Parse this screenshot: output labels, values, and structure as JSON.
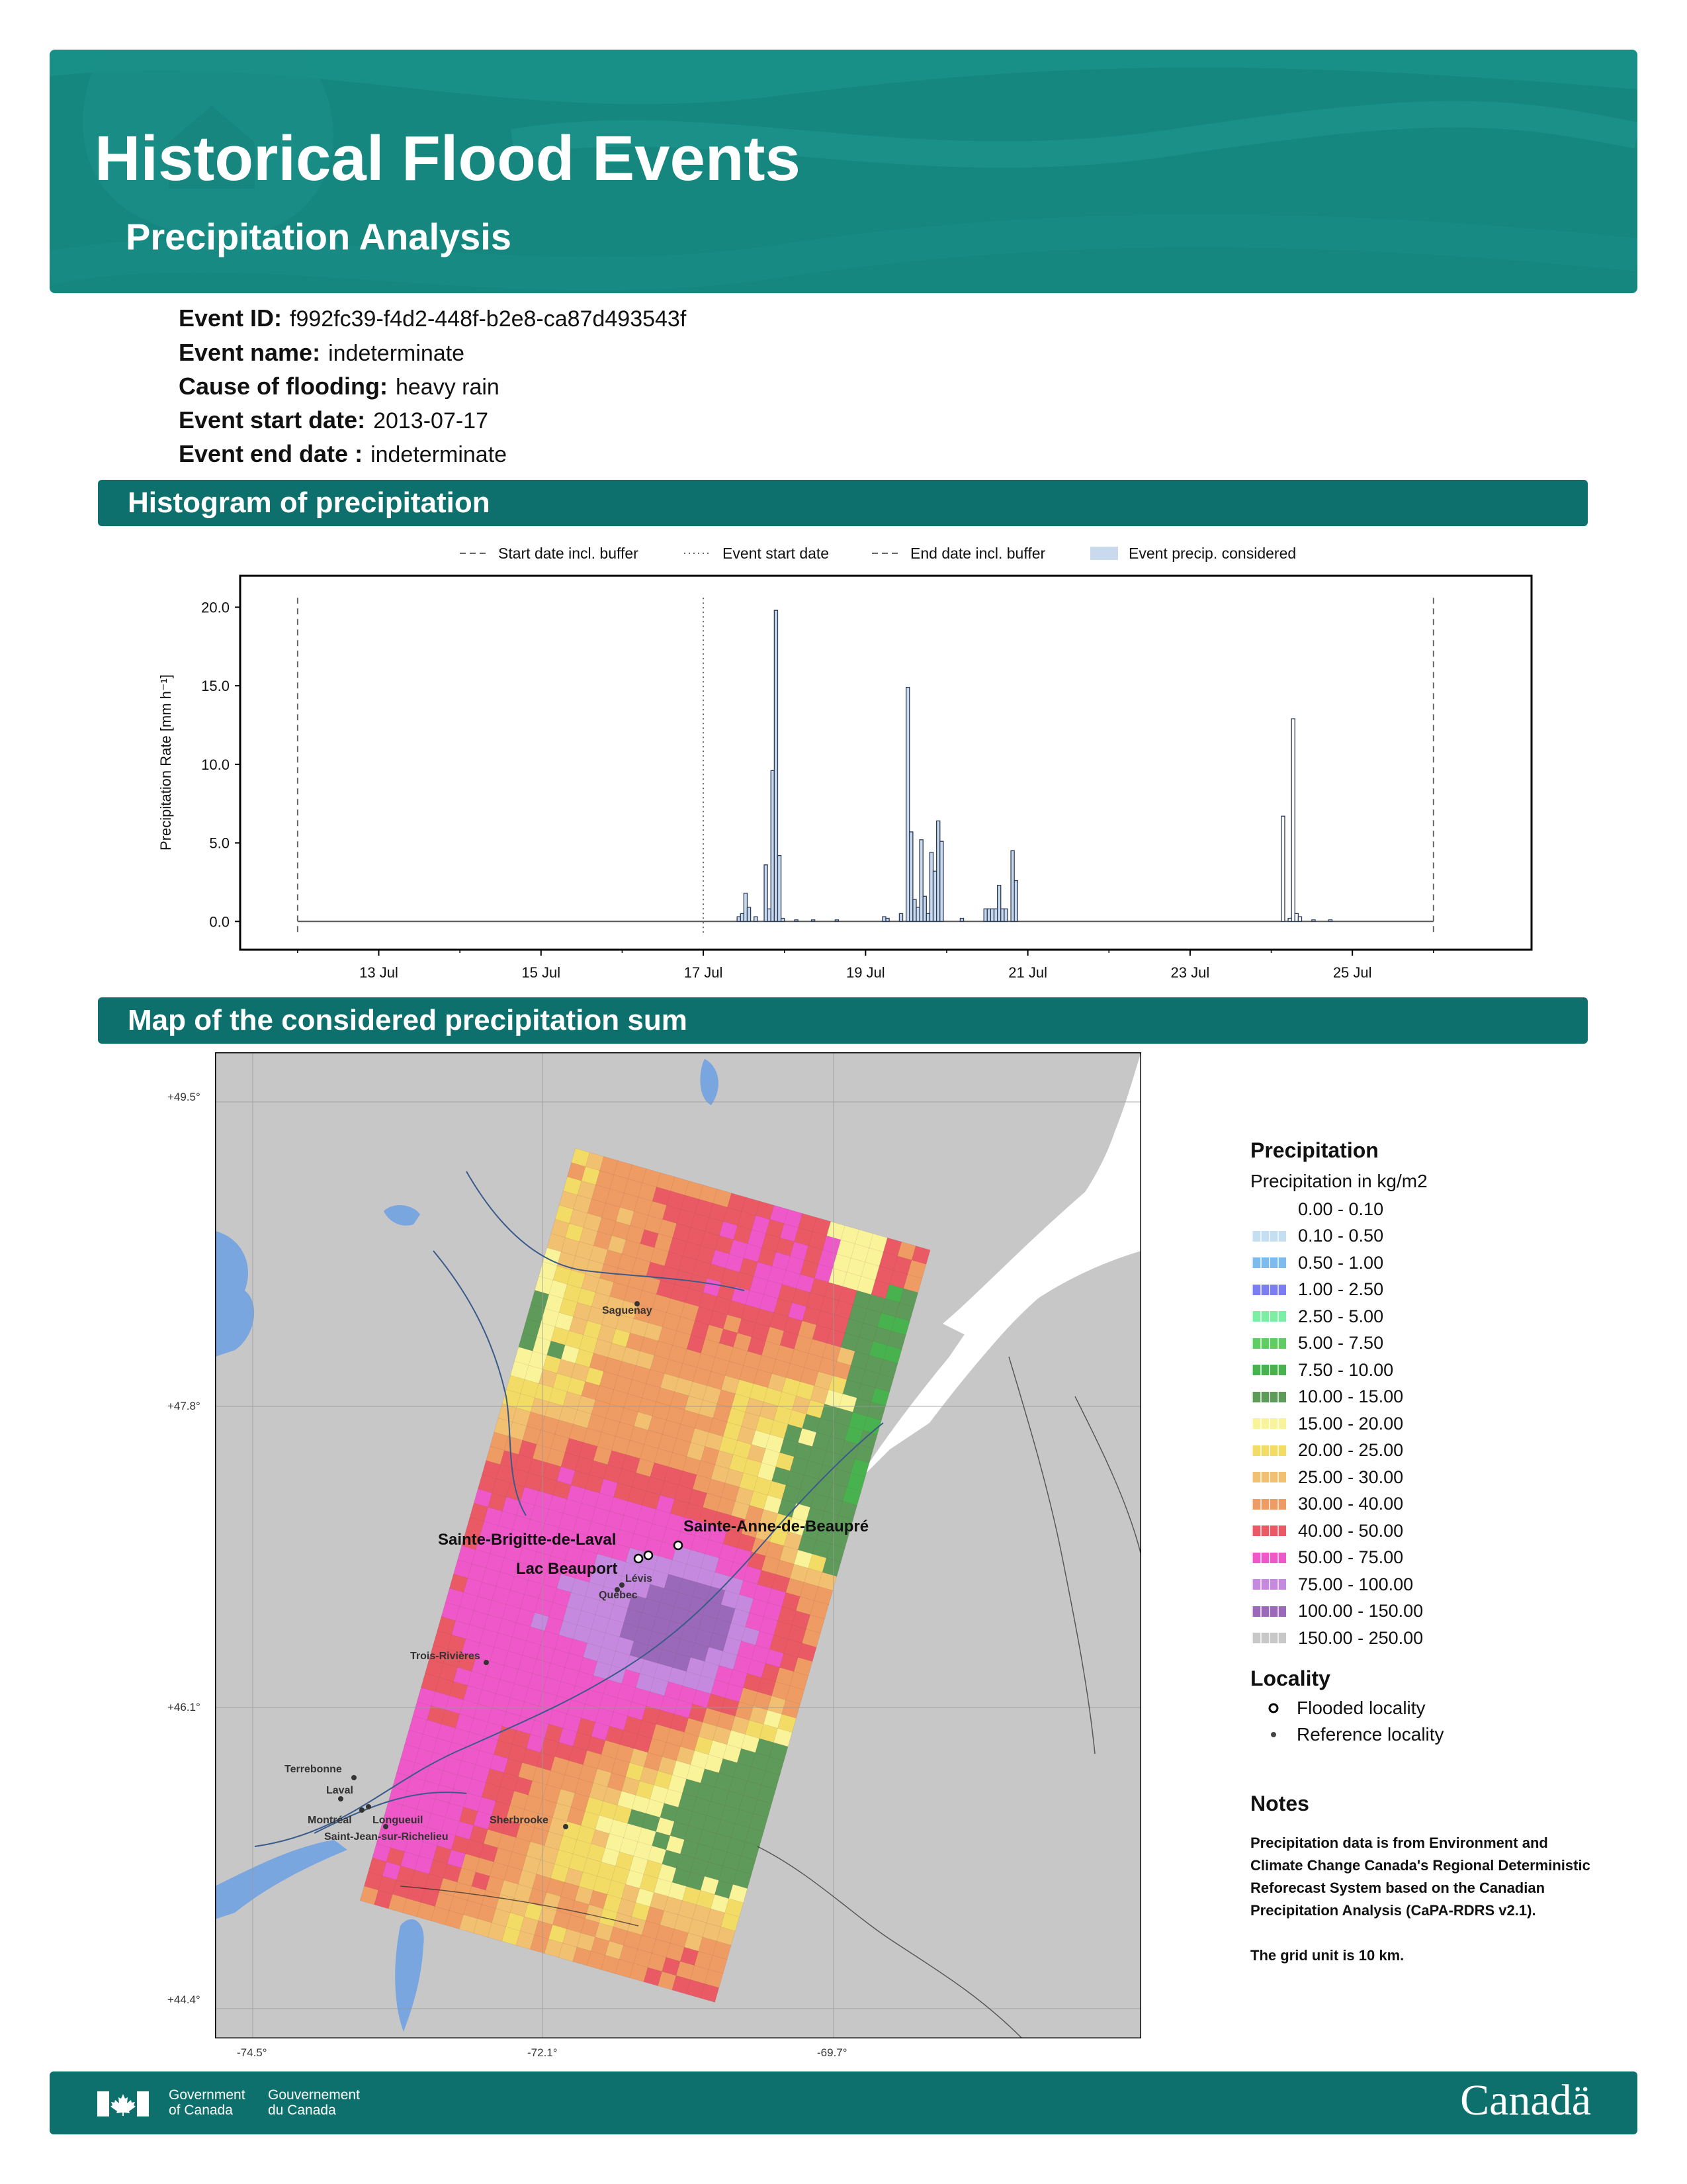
{
  "header": {
    "title": "Historical Flood Events",
    "subtitle": "Precipitation Analysis",
    "color": "#15877f"
  },
  "event": {
    "fields": [
      {
        "label": "Event ID:",
        "value": "f992fc39-f4d2-448f-b2e8-ca87d493543f"
      },
      {
        "label": "Event name:",
        "value": "indeterminate"
      },
      {
        "label": "Cause of flooding:",
        "value": "heavy rain"
      },
      {
        "label": "Event start date:",
        "value": "2013-07-17"
      },
      {
        "label": "Event end date :",
        "value": "indeterminate"
      }
    ]
  },
  "sections": {
    "histogram": "Histogram of precipitation",
    "map": "Map of the considered precipitation sum"
  },
  "chart_data": {
    "type": "bar",
    "title": "",
    "xlabel": "",
    "ylabel": "Precipitation Rate [mm h⁻¹]",
    "ylim": [
      -1.8,
      22
    ],
    "xlim": [
      "2013-07-11T07:00",
      "2013-07-27T05:00"
    ],
    "x_tick_labels": [
      "13 Jul",
      "15 Jul",
      "17 Jul",
      "19 Jul",
      "21 Jul",
      "23 Jul",
      "25 Jul"
    ],
    "x_ticks": [
      "2013-07-13",
      "2013-07-15",
      "2013-07-17",
      "2013-07-19",
      "2013-07-21",
      "2013-07-23",
      "2013-07-25"
    ],
    "y_tick_labels": [
      "0.0",
      "5.0",
      "10.0",
      "15.0",
      "20.0"
    ],
    "y_ticks": [
      0,
      5,
      10,
      15,
      20
    ],
    "legend": [
      {
        "label": "Start date incl. buffer",
        "style": "dashed"
      },
      {
        "label": "Event start date",
        "style": "dotted"
      },
      {
        "label": "End date incl. buffer",
        "style": "dashed"
      },
      {
        "label": "Event precip. considered",
        "style": "patch"
      }
    ],
    "legend_position": "top",
    "grid": false,
    "vlines": {
      "start_buffer": "2013-07-12T00:00",
      "event_start": "2013-07-17T00:00",
      "end_buffer": "2013-07-26T00:00"
    },
    "bar_width_hours": 1,
    "series": [
      {
        "values": [
          [
            "2013-07-17T10:00",
            0.3
          ],
          [
            "2013-07-17T11:00",
            0.5
          ],
          [
            "2013-07-17T12:00",
            1.8
          ],
          [
            "2013-07-17T13:00",
            0.9
          ],
          [
            "2013-07-17T15:00",
            0.3
          ],
          [
            "2013-07-17T18:00",
            3.6
          ],
          [
            "2013-07-17T19:00",
            0.8
          ],
          [
            "2013-07-17T20:00",
            9.6
          ],
          [
            "2013-07-17T21:00",
            19.8
          ],
          [
            "2013-07-17T22:00",
            4.2
          ],
          [
            "2013-07-17T23:00",
            0.2
          ],
          [
            "2013-07-18T03:00",
            0.1
          ],
          [
            "2013-07-18T08:00",
            0.1
          ],
          [
            "2013-07-18T15:00",
            0.1
          ],
          [
            "2013-07-19T05:00",
            0.3
          ],
          [
            "2013-07-19T06:00",
            0.2
          ],
          [
            "2013-07-19T10:00",
            0.5
          ],
          [
            "2013-07-19T12:00",
            14.9
          ],
          [
            "2013-07-19T13:00",
            5.7
          ],
          [
            "2013-07-19T14:00",
            1.4
          ],
          [
            "2013-07-19T15:00",
            0.9
          ],
          [
            "2013-07-19T16:00",
            5.2
          ],
          [
            "2013-07-19T17:00",
            1.6
          ],
          [
            "2013-07-19T18:00",
            0.5
          ],
          [
            "2013-07-19T19:00",
            4.4
          ],
          [
            "2013-07-19T20:00",
            3.2
          ],
          [
            "2013-07-19T21:00",
            6.4
          ],
          [
            "2013-07-19T22:00",
            5.1
          ],
          [
            "2013-07-20T04:00",
            0.2
          ],
          [
            "2013-07-20T11:00",
            0.8
          ],
          [
            "2013-07-20T12:00",
            0.8
          ],
          [
            "2013-07-20T13:00",
            0.8
          ],
          [
            "2013-07-20T14:00",
            0.8
          ],
          [
            "2013-07-20T15:00",
            2.3
          ],
          [
            "2013-07-20T16:00",
            0.8
          ],
          [
            "2013-07-20T17:00",
            0.8
          ],
          [
            "2013-07-20T19:00",
            4.5
          ],
          [
            "2013-07-20T20:00",
            2.6
          ],
          [
            "2013-07-24T03:00",
            6.7
          ],
          [
            "2013-07-24T05:00",
            0.2
          ],
          [
            "2013-07-24T06:00",
            12.9
          ],
          [
            "2013-07-24T07:00",
            0.5
          ],
          [
            "2013-07-24T08:00",
            0.3
          ],
          [
            "2013-07-24T12:00",
            0.1
          ],
          [
            "2013-07-24T17:00",
            0.1
          ]
        ]
      }
    ]
  },
  "map": {
    "lat_labels": [
      "+49.5°",
      "+47.8°",
      "+46.1°",
      "+44.4°"
    ],
    "lon_labels": [
      "-74.5°",
      "-72.1°",
      "-69.7°"
    ],
    "flooded_localities": [
      "Sainte-Brigitte-de-Laval",
      "Sainte-Anne-de-Beaupré",
      "Lac Beauport"
    ],
    "reference_localities": [
      "Saguenay",
      "Lévis",
      "Québec",
      "Trois-Rivières",
      "Terrebonne",
      "Laval",
      "Montréal",
      "Longueuil",
      "Saint-Jean-sur-Richelieu",
      "Sherbrooke"
    ]
  },
  "legend": {
    "precip_title": "Precipitation",
    "precip_subtitle": "Precipitation in kg/m2",
    "classes": [
      {
        "label": "0.00 - 0.10",
        "color": "#ffffff"
      },
      {
        "label": "0.10 - 0.50",
        "color": "#c4dff2"
      },
      {
        "label": "0.50 - 1.00",
        "color": "#7dbbee"
      },
      {
        "label": "1.00 - 2.50",
        "color": "#7b7ef0"
      },
      {
        "label": "2.50 - 5.00",
        "color": "#7cefa4"
      },
      {
        "label": "5.00 - 7.50",
        "color": "#5fcc64"
      },
      {
        "label": "7.50 - 10.00",
        "color": "#48b24e"
      },
      {
        "label": "10.00 - 15.00",
        "color": "#5e9a5a"
      },
      {
        "label": "15.00 - 20.00",
        "color": "#f9f49a"
      },
      {
        "label": "20.00 - 25.00",
        "color": "#f3dc66"
      },
      {
        "label": "25.00 - 30.00",
        "color": "#f1c070"
      },
      {
        "label": "30.00 - 40.00",
        "color": "#ee9c63"
      },
      {
        "label": "40.00 - 50.00",
        "color": "#ea5a64"
      },
      {
        "label": "50.00 - 75.00",
        "color": "#ee58c8"
      },
      {
        "label": "75.00 - 100.00",
        "color": "#c58ae0"
      },
      {
        "label": "100.00 - 150.00",
        "color": "#9b69b9"
      },
      {
        "label": "150.00 - 250.00",
        "color": "#c8c8c8"
      }
    ],
    "locality_title": "Locality",
    "flooded_label": "Flooded locality",
    "reference_label": "Reference locality",
    "notes_title": "Notes",
    "notes_text": "Precipitation data is from Environment and Climate Change Canada's Regional Deterministic Reforecast System based on the Canadian Precipitation Analysis (CaPA-RDRS v2.1).",
    "notes_grid": "The grid unit is 10 km."
  },
  "footer": {
    "gov_en_1": "Government",
    "gov_en_2": "of Canada",
    "gov_fr_1": "Gouvernement",
    "gov_fr_2": "du Canada",
    "wordmark": "Canadä"
  }
}
